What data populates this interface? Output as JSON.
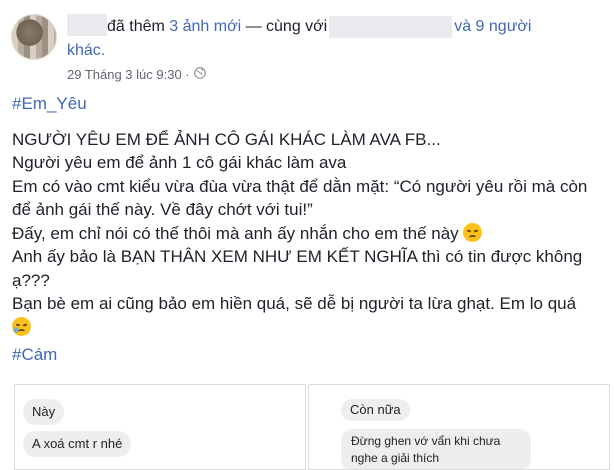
{
  "header": {
    "text_before_first_blur": "",
    "action_text": "đã thêm 3 ảnh mới — cùng với ",
    "with_suffix": "và 9 người",
    "line2": "khác."
  },
  "meta": {
    "timestamp": "29 Tháng 3 lúc 9:30 ·",
    "privacy_icon": "globe-icon"
  },
  "post": {
    "hashtag_top": "#Em_Yêu",
    "lines": [
      "NGƯỜI YÊU EM ĐỂ ẢNH CÔ GÁI KHÁC LÀM AVA FB...",
      "Người yêu em để ảnh 1 cô gái khác làm ava",
      "Em có vào cmt kiểu vừa đùa vừa thật để dằn mặt: “Có người yêu rồi mà còn",
      "để ảnh gái thế này. Về đây chớt với tui!”",
      "Đấy, em chỉ nói có thế thôi mà anh ấy nhắn cho em thế này",
      "Anh ấy bảo là BẠN THÂN XEM NHƯ EM KẾT NGHĨA thì có tin được không",
      "ạ???",
      "Bạn bè em ai cũng bảo em hiền quá, sẽ dễ bị người ta lừa ghạt. Em lo quá"
    ],
    "hashtag_bottom": "#Cám"
  },
  "emojis": {
    "sad": "sad-face-emoji",
    "cry": "crying-face-emoji"
  },
  "screenshots": {
    "left": [
      "Này",
      "A xoá cmt r nhé"
    ],
    "right": [
      "Còn nữa",
      "Đừng ghen vớ vẩn khi chưa nghe a giải thích"
    ]
  }
}
